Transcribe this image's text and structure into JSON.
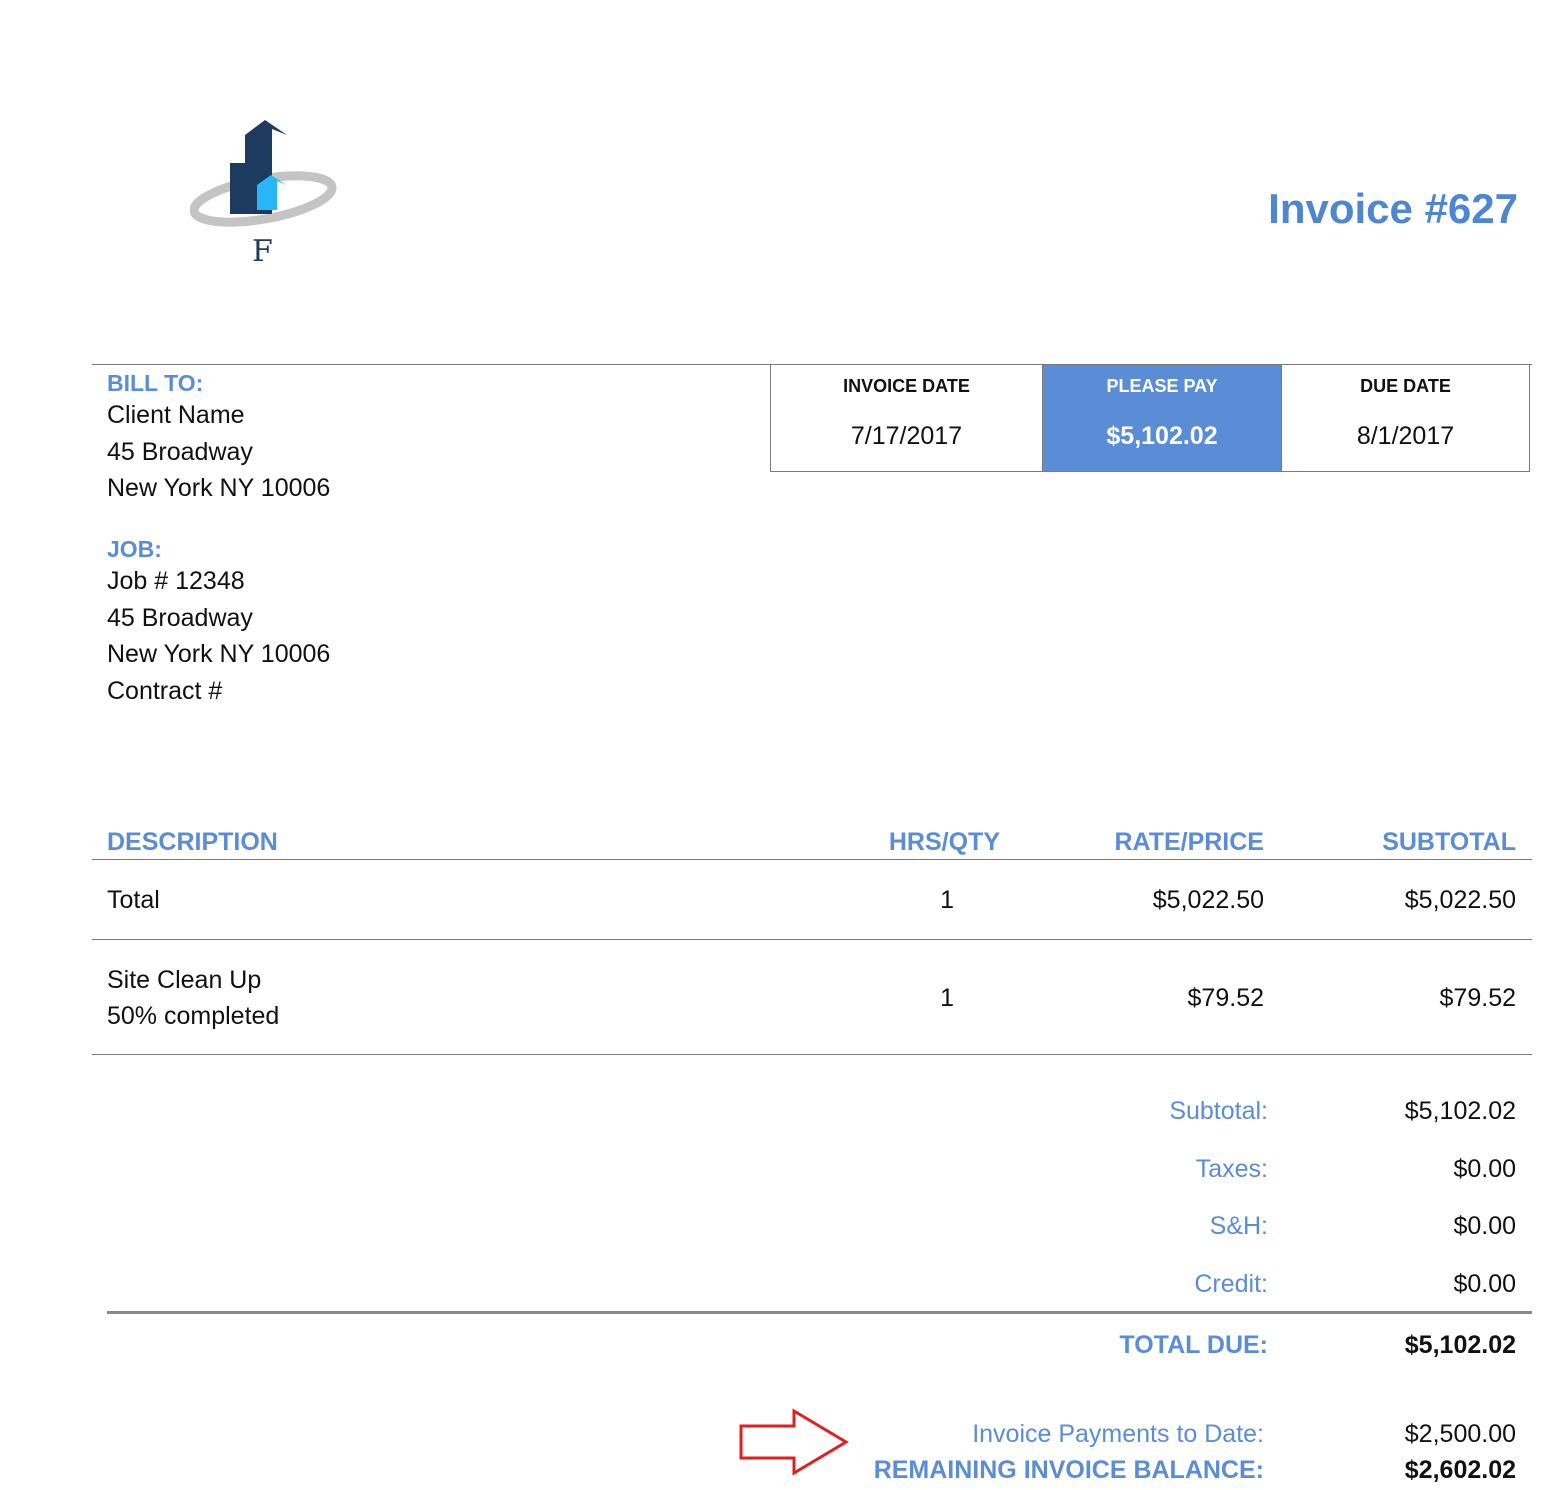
{
  "header": {
    "logo_letter": "F",
    "invoice_title": "Invoice #627"
  },
  "bill_to": {
    "label": "BILL TO:",
    "lines": [
      "Client Name",
      "45 Broadway",
      "New York NY 10006"
    ]
  },
  "job": {
    "label": "JOB:",
    "lines": [
      "Job # 12348",
      "45 Broadway",
      "New York NY 10006",
      "Contract #"
    ]
  },
  "summary_box": {
    "invoice_date_label": "INVOICE DATE",
    "invoice_date": "7/17/2017",
    "please_pay_label": "PLEASE PAY",
    "please_pay": "$5,102.02",
    "due_date_label": "DUE DATE",
    "due_date": "8/1/2017"
  },
  "items": {
    "headers": {
      "description": "DESCRIPTION",
      "qty": "HRS/QTY",
      "rate": "RATE/PRICE",
      "subtotal": "SUBTOTAL"
    },
    "rows": [
      {
        "description": "Total",
        "description2": "",
        "qty": "1",
        "rate": "$5,022.50",
        "subtotal": "$5,022.50"
      },
      {
        "description": "Site Clean Up",
        "description2": "50% completed",
        "qty": "1",
        "rate": "$79.52",
        "subtotal": "$79.52"
      }
    ]
  },
  "totals": {
    "subtotal_label": "Subtotal:",
    "subtotal": "$5,102.02",
    "taxes_label": "Taxes:",
    "taxes": "$0.00",
    "sh_label": "S&H:",
    "sh": "$0.00",
    "credit_label": "Credit:",
    "credit": "$0.00",
    "total_due_label": "TOTAL DUE:",
    "total_due": "$5,102.02",
    "payments_label": "Invoice Payments to Date:",
    "payments": "$2,500.00",
    "remaining_label": "REMAINING INVOICE BALANCE:",
    "remaining": "$2,602.02"
  },
  "colors": {
    "accent": "#5b8dd6",
    "logo_dark": "#1d3a5f",
    "logo_light": "#29b6f6",
    "arrow": "#e02020"
  },
  "icons": {
    "logo": "building-logo-icon",
    "arrow": "right-arrow-icon"
  }
}
